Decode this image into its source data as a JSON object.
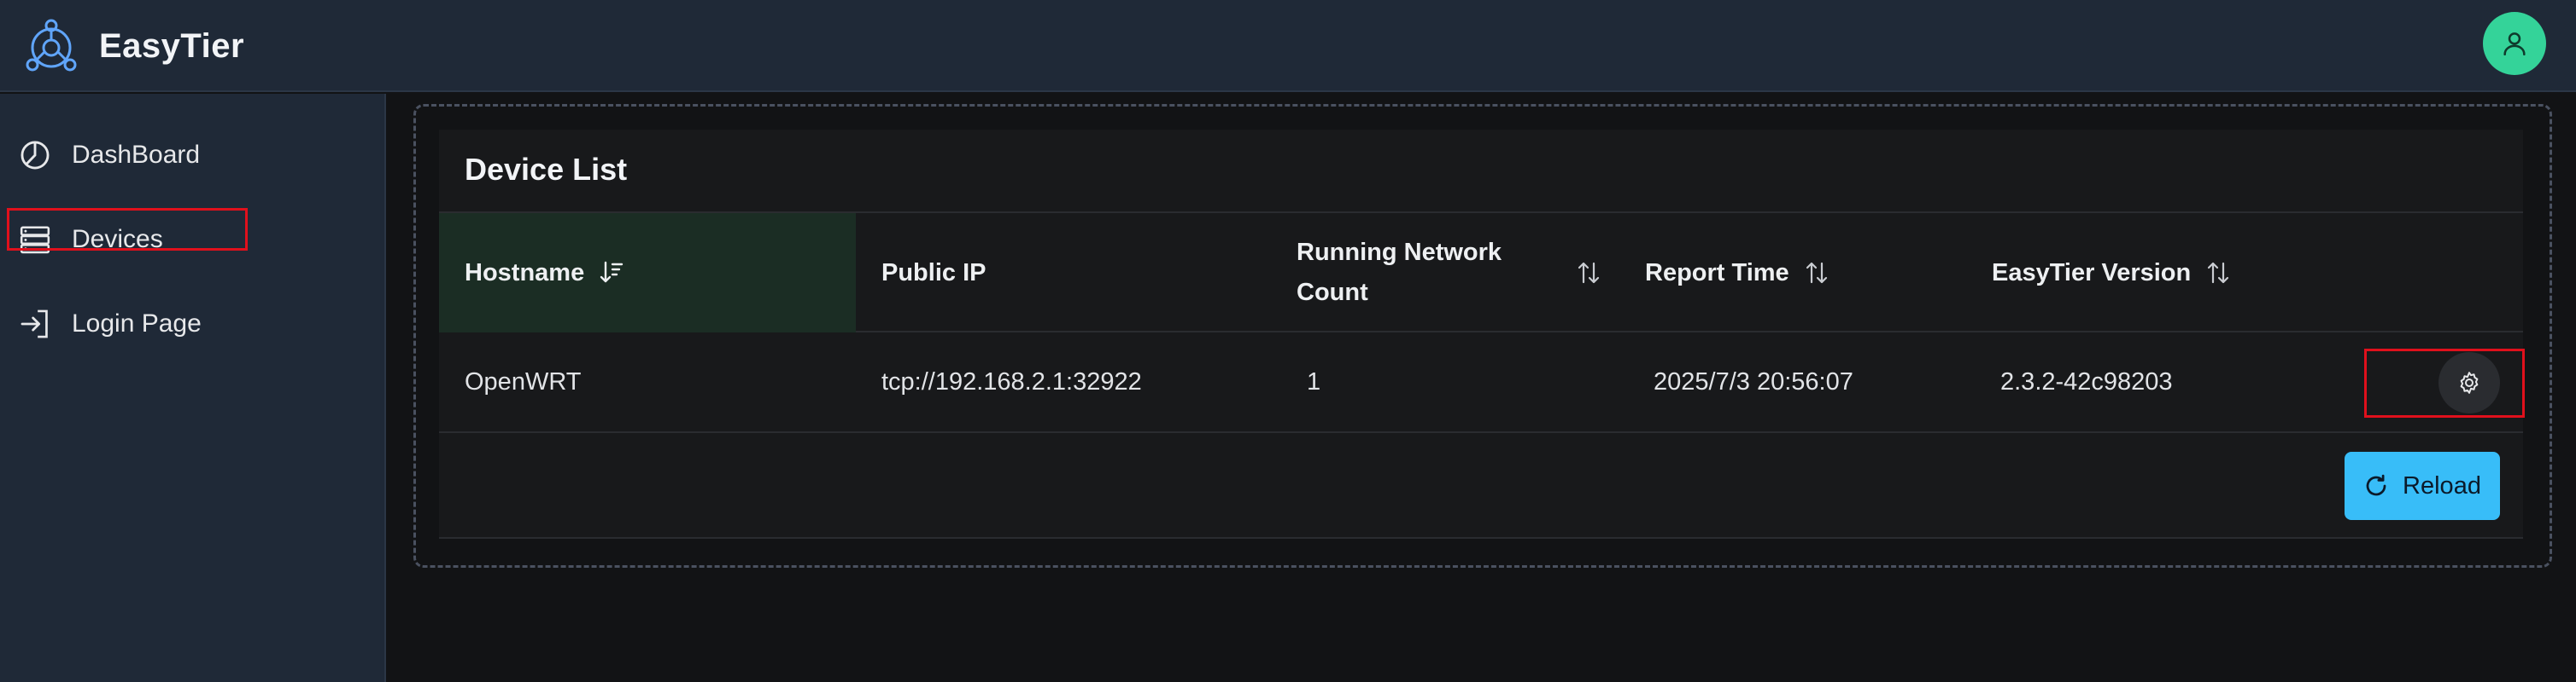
{
  "app": {
    "name": "EasyTier"
  },
  "sidebar": {
    "items": [
      {
        "label": "DashBoard",
        "icon": "chart-pie-icon"
      },
      {
        "label": "Devices",
        "icon": "server-icon"
      },
      {
        "label": "Login Page",
        "icon": "sign-in-icon"
      }
    ]
  },
  "device_list": {
    "title": "Device List",
    "columns": [
      "Hostname",
      "Public IP",
      "Running Network Count",
      "Report Time",
      "EasyTier Version"
    ],
    "rows": [
      {
        "hostname": "OpenWRT",
        "public_ip": "tcp://192.168.2.1:32922",
        "running_network_count": "1",
        "report_time": "2025/7/3 20:56:07",
        "version": "2.3.2-42c98203"
      }
    ],
    "reload_label": "Reload"
  },
  "colors": {
    "accent": "#38bdf8",
    "avatar": "#34d399",
    "sorted_header_bg": "#1b2d24",
    "highlight": "#e0101c"
  }
}
